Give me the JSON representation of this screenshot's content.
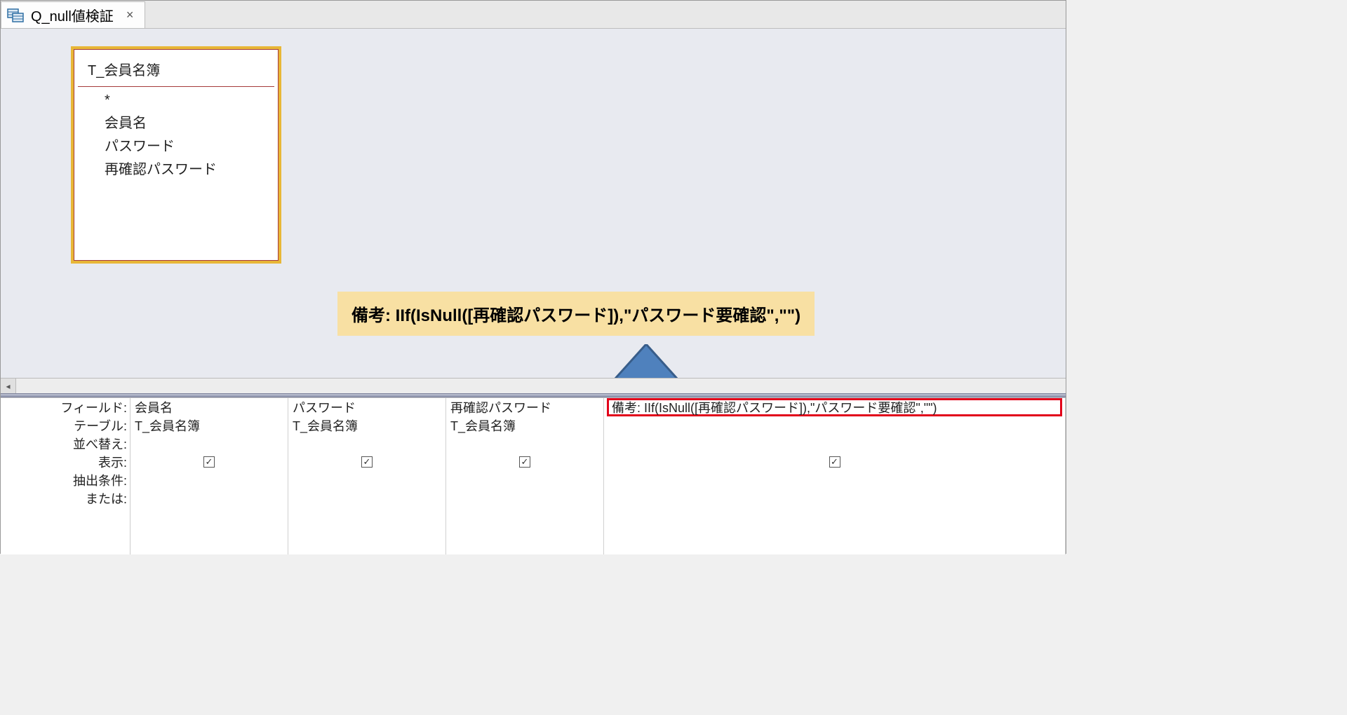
{
  "tab": {
    "title": "Q_null値検証",
    "close_glyph": "×"
  },
  "table_box": {
    "title": "T_会員名簿",
    "fields": [
      "*",
      "会員名",
      "パスワード",
      "再確認パスワード"
    ]
  },
  "callout": {
    "text": "備考: IIf(IsNull([再確認パスワード]),\"パスワード要確認\",\"\")"
  },
  "grid": {
    "labels": {
      "field": "フィールド:",
      "table": "テーブル:",
      "sort": "並べ替え:",
      "show": "表示:",
      "criteria": "抽出条件:",
      "or": "または:"
    },
    "columns": [
      {
        "field": "会員名",
        "table": "T_会員名簿",
        "show": true,
        "highlight": false
      },
      {
        "field": "パスワード",
        "table": "T_会員名簿",
        "show": true,
        "highlight": false
      },
      {
        "field": "再確認パスワード",
        "table": "T_会員名簿",
        "show": true,
        "highlight": false
      },
      {
        "field": "備考: IIf(IsNull([再確認パスワード]),\"パスワード要確認\",\"\")",
        "table": "",
        "show": true,
        "highlight": true
      }
    ]
  },
  "check_glyph": "✓",
  "scroll_left_glyph": "◂"
}
